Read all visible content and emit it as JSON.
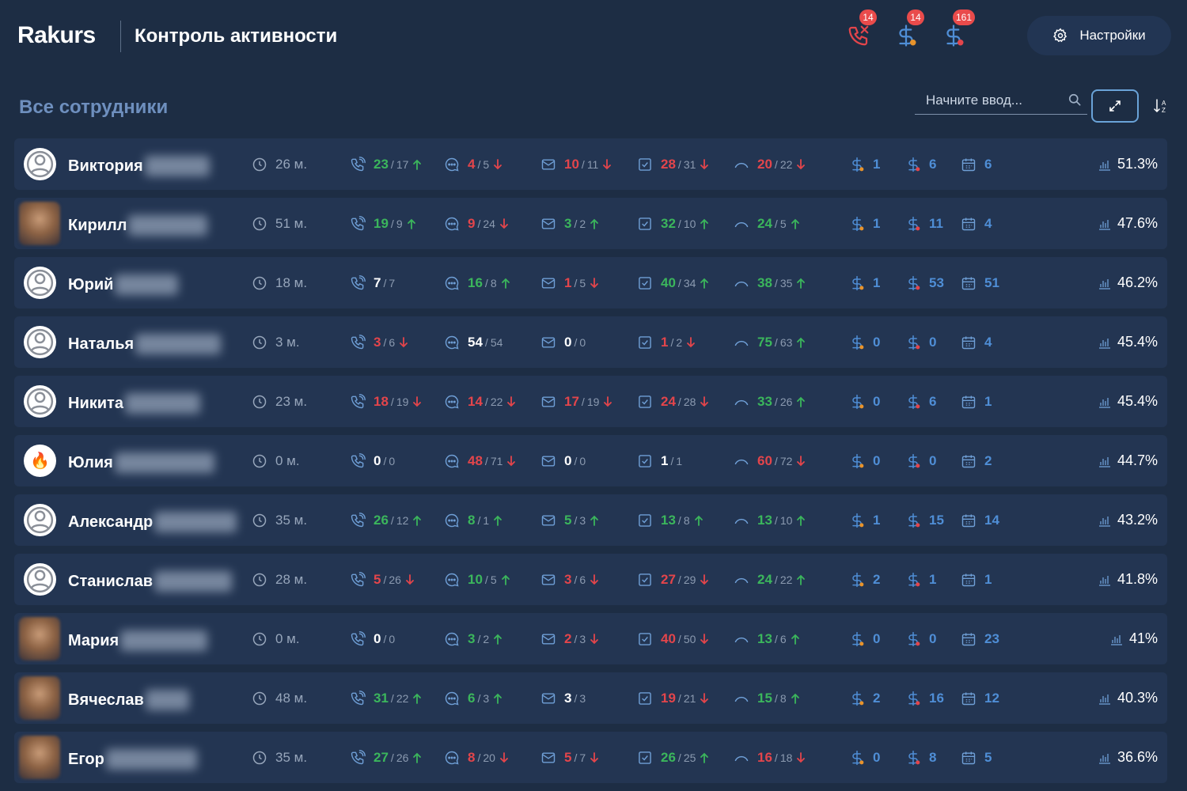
{
  "header": {
    "logo": "Rakurs",
    "title": "Контроль активности",
    "notifications": [
      {
        "icon": "phone-missed-icon",
        "count": "14"
      },
      {
        "icon": "dollar-orange-icon",
        "count": "14"
      },
      {
        "icon": "dollar-red-icon",
        "count": "161"
      }
    ],
    "settings_label": "Настройки"
  },
  "toolbar": {
    "section_title": "Все сотрудники",
    "search_placeholder": "Начните ввод..."
  },
  "colors": {
    "green": "#3bb65c",
    "red": "#e3454b",
    "blue": "#4f8ed6",
    "bg": "#1d2d44",
    "row": "#233552"
  },
  "employees": [
    {
      "name": "Виктория",
      "avatar": "default",
      "time": "26 м.",
      "calls": [
        "23",
        "17",
        "up"
      ],
      "msgs": [
        "4",
        "5",
        "down"
      ],
      "mail": [
        "10",
        "11",
        "down"
      ],
      "tasks": [
        "28",
        "31",
        "down"
      ],
      "trend": [
        "20",
        "22",
        "down"
      ],
      "d1": "1",
      "d2": "6",
      "cal": "6",
      "pct": "51.3%"
    },
    {
      "name": "Кирилл",
      "avatar": "photo",
      "time": "51 м.",
      "calls": [
        "19",
        "9",
        "up"
      ],
      "msgs": [
        "9",
        "24",
        "down"
      ],
      "mail": [
        "3",
        "2",
        "up"
      ],
      "tasks": [
        "32",
        "10",
        "up"
      ],
      "trend": [
        "24",
        "5",
        "up"
      ],
      "d1": "1",
      "d2": "11",
      "cal": "4",
      "pct": "47.6%"
    },
    {
      "name": "Юрий",
      "avatar": "default",
      "time": "18 м.",
      "calls": [
        "7",
        "7",
        "none"
      ],
      "msgs": [
        "16",
        "8",
        "up"
      ],
      "mail": [
        "1",
        "5",
        "down"
      ],
      "tasks": [
        "40",
        "34",
        "up"
      ],
      "trend": [
        "38",
        "35",
        "up"
      ],
      "d1": "1",
      "d2": "53",
      "cal": "51",
      "pct": "46.2%"
    },
    {
      "name": "Наталья",
      "avatar": "default",
      "time": "3 м.",
      "calls": [
        "3",
        "6",
        "down"
      ],
      "msgs": [
        "54",
        "54",
        "none"
      ],
      "mail": [
        "0",
        "0",
        "none"
      ],
      "tasks": [
        "1",
        "2",
        "down"
      ],
      "trend": [
        "75",
        "63",
        "up"
      ],
      "d1": "0",
      "d2": "0",
      "cal": "4",
      "pct": "45.4%"
    },
    {
      "name": "Никита",
      "avatar": "default",
      "time": "23 м.",
      "calls": [
        "18",
        "19",
        "down"
      ],
      "msgs": [
        "14",
        "22",
        "down"
      ],
      "mail": [
        "17",
        "19",
        "down"
      ],
      "tasks": [
        "24",
        "28",
        "down"
      ],
      "trend": [
        "33",
        "26",
        "up"
      ],
      "d1": "0",
      "d2": "6",
      "cal": "1",
      "pct": "45.4%"
    },
    {
      "name": "Юлия",
      "avatar": "fire",
      "time": "0 м.",
      "calls": [
        "0",
        "0",
        "none"
      ],
      "msgs": [
        "48",
        "71",
        "down"
      ],
      "mail": [
        "0",
        "0",
        "none"
      ],
      "tasks": [
        "1",
        "1",
        "none"
      ],
      "trend": [
        "60",
        "72",
        "down"
      ],
      "d1": "0",
      "d2": "0",
      "cal": "2",
      "pct": "44.7%"
    },
    {
      "name": "Александр",
      "avatar": "default",
      "time": "35 м.",
      "calls": [
        "26",
        "12",
        "up"
      ],
      "msgs": [
        "8",
        "1",
        "up"
      ],
      "mail": [
        "5",
        "3",
        "up"
      ],
      "tasks": [
        "13",
        "8",
        "up"
      ],
      "trend": [
        "13",
        "10",
        "up"
      ],
      "d1": "1",
      "d2": "15",
      "cal": "14",
      "pct": "43.2%"
    },
    {
      "name": "Станислав",
      "avatar": "default",
      "time": "28 м.",
      "calls": [
        "5",
        "26",
        "down"
      ],
      "msgs": [
        "10",
        "5",
        "up"
      ],
      "mail": [
        "3",
        "6",
        "down"
      ],
      "tasks": [
        "27",
        "29",
        "down"
      ],
      "trend": [
        "24",
        "22",
        "up"
      ],
      "d1": "2",
      "d2": "1",
      "cal": "1",
      "pct": "41.8%"
    },
    {
      "name": "Мария",
      "avatar": "photo",
      "time": "0 м.",
      "calls": [
        "0",
        "0",
        "none"
      ],
      "msgs": [
        "3",
        "2",
        "up"
      ],
      "mail": [
        "2",
        "3",
        "down"
      ],
      "tasks": [
        "40",
        "50",
        "down"
      ],
      "trend": [
        "13",
        "6",
        "up"
      ],
      "d1": "0",
      "d2": "0",
      "cal": "23",
      "pct": "41%"
    },
    {
      "name": "Вячеслав",
      "avatar": "photo",
      "time": "48 м.",
      "calls": [
        "31",
        "22",
        "up"
      ],
      "msgs": [
        "6",
        "3",
        "up"
      ],
      "mail": [
        "3",
        "3",
        "none"
      ],
      "tasks": [
        "19",
        "21",
        "down"
      ],
      "trend": [
        "15",
        "8",
        "up"
      ],
      "d1": "2",
      "d2": "16",
      "cal": "12",
      "pct": "40.3%"
    },
    {
      "name": "Егор",
      "avatar": "photo",
      "time": "35 м.",
      "calls": [
        "27",
        "26",
        "up"
      ],
      "msgs": [
        "8",
        "20",
        "down"
      ],
      "mail": [
        "5",
        "7",
        "down"
      ],
      "tasks": [
        "26",
        "25",
        "up"
      ],
      "trend": [
        "16",
        "18",
        "down"
      ],
      "d1": "0",
      "d2": "8",
      "cal": "5",
      "pct": "36.6%"
    }
  ]
}
